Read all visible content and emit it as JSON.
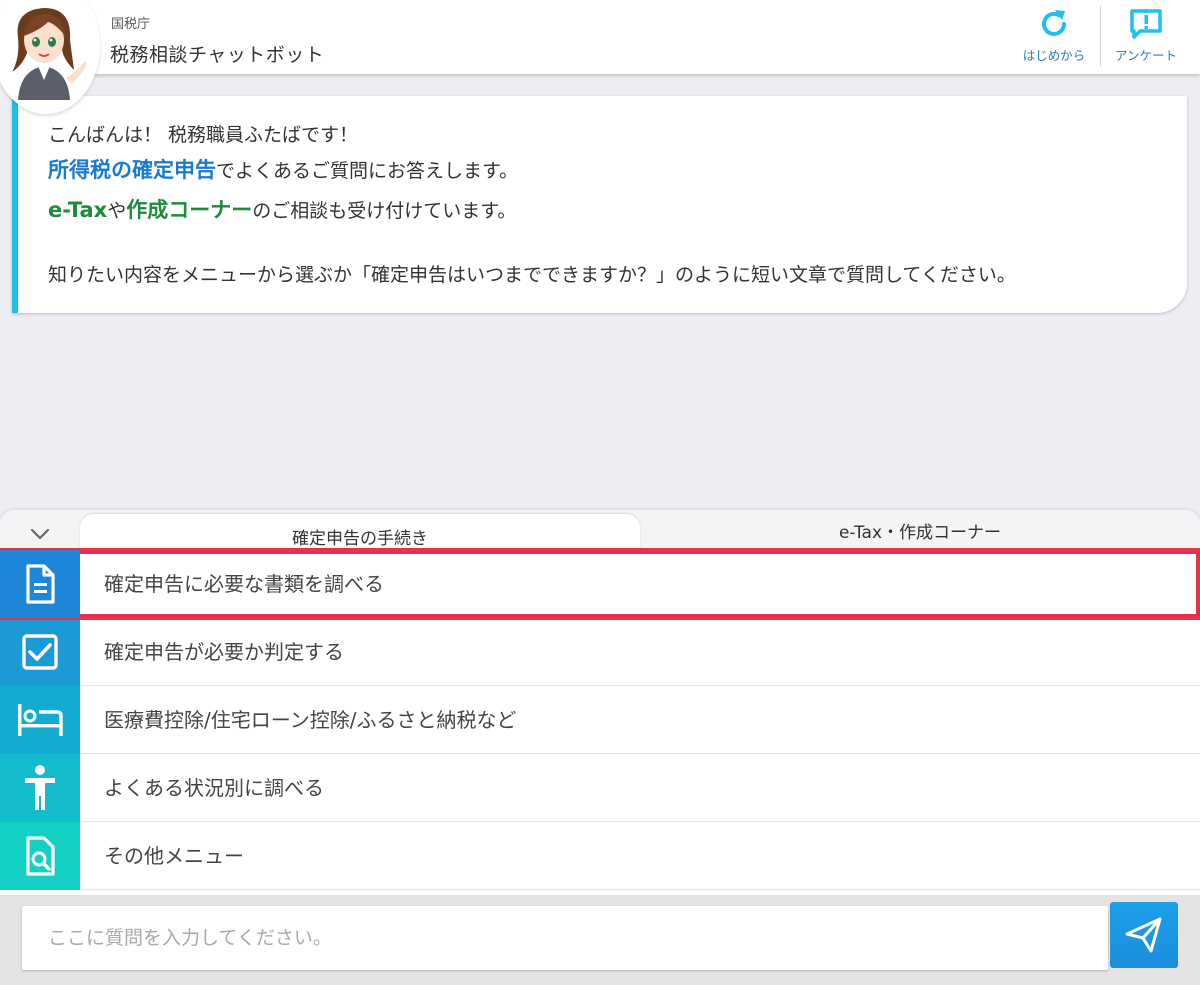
{
  "header": {
    "agency": "国税庁",
    "title": "税務相談チャットボット",
    "restart_label": "はじめから",
    "survey_label": "アンケート",
    "accent": "#1ec0f0"
  },
  "greeting": {
    "line1": "こんばんは！ 税務職員ふたばです！",
    "line2_highlight": "所得税の確定申告",
    "line2_rest": "でよくあるご質問にお答えします。",
    "line3_hl1": "e-Tax",
    "line3_mid": "や",
    "line3_hl2": "作成コーナー",
    "line3_rest": "のご相談も受け付けています。",
    "line4": "知りたい内容をメニューから選ぶか「確定申告はいつまでできますか？」のように短い文章で質問してください。"
  },
  "tabs": [
    {
      "label": "確定申告の手続き",
      "active": true
    },
    {
      "label": "e-Tax・作成コーナー",
      "active": false
    }
  ],
  "menu": [
    {
      "label": "確定申告に必要な書類を調べる",
      "icon": "document-icon",
      "color": "#1e86d8",
      "selected": true
    },
    {
      "label": "確定申告が必要か判定する",
      "icon": "checkbox-icon",
      "color": "#1a9ad6",
      "selected": false
    },
    {
      "label": "医療費控除/住宅ローン控除/ふるさと納税など",
      "icon": "bed-icon",
      "color": "#14abd3",
      "selected": false
    },
    {
      "label": "よくある状況別に調べる",
      "icon": "person-icon",
      "color": "#12bccd",
      "selected": false
    },
    {
      "label": "その他メニュー",
      "icon": "document-search-icon",
      "color": "#14cfc4",
      "selected": false
    }
  ],
  "input": {
    "placeholder": "ここに質問を入力してください。",
    "value": ""
  },
  "colors": {
    "highlight_blue": "#1a7acd",
    "highlight_green": "#1b8b3c",
    "selection_outline": "#e8314a",
    "send_button": "#1d9fe8"
  }
}
